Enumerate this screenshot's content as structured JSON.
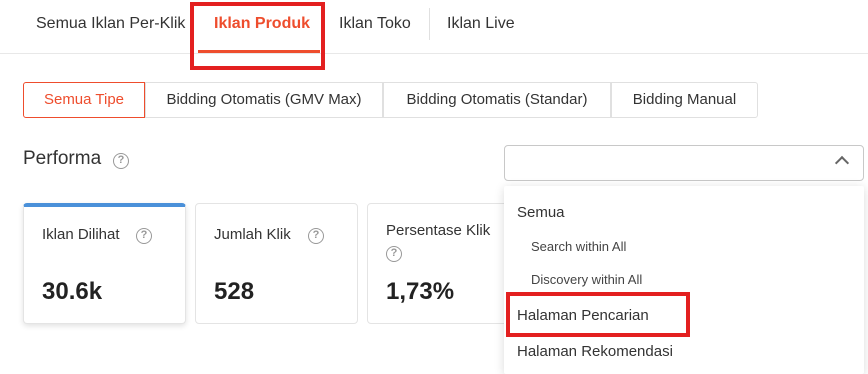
{
  "tabs": [
    {
      "label": "Semua Iklan Per-Klik"
    },
    {
      "label": "Iklan Produk",
      "active": true
    },
    {
      "label": "Iklan Toko"
    },
    {
      "label": "Iklan Live"
    }
  ],
  "ad_types": [
    {
      "label": "Semua Tipe",
      "active": true
    },
    {
      "label": "Bidding Otomatis (GMV Max)"
    },
    {
      "label": "Bidding Otomatis (Standar)"
    },
    {
      "label": "Bidding Manual"
    }
  ],
  "performance": {
    "title": "Performa",
    "select_value": ""
  },
  "metrics": [
    {
      "label": "Iklan Dilihat",
      "value": "30.6k"
    },
    {
      "label": "Jumlah Klik",
      "value": "528"
    },
    {
      "label": "Persentase Klik",
      "value": "1,73%"
    }
  ],
  "dropdown_options": [
    {
      "label": "Semua"
    },
    {
      "label": "Search within All"
    },
    {
      "label": "Discovery within All"
    },
    {
      "label": "Halaman Pencarian"
    },
    {
      "label": "Halaman Rekomendasi"
    }
  ],
  "colors": {
    "accent": "#ee4d2d",
    "highlight": "#e32020",
    "card_top": "#4a90d9"
  },
  "icons": {
    "help": "question-circle-icon",
    "chevron": "chevron-up-icon"
  }
}
